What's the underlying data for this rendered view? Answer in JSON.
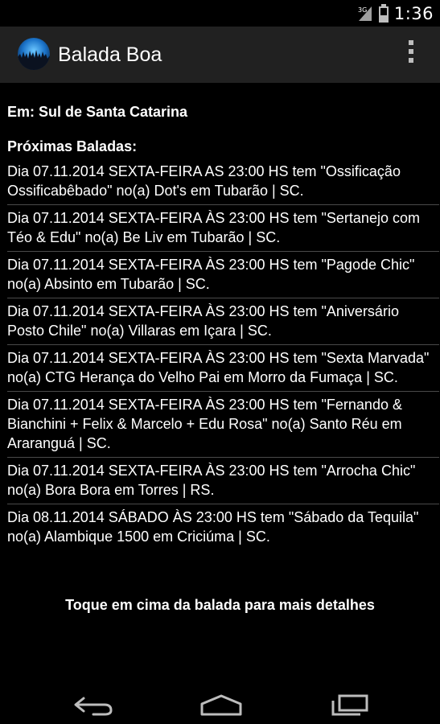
{
  "status_bar": {
    "signal_label": "3G",
    "time": "1:36"
  },
  "action_bar": {
    "title": "Balada Boa",
    "app_icon": "crowd-globe-icon",
    "overflow_icon": "overflow-menu-icon"
  },
  "content": {
    "region": "Em: Sul de Santa Catarina",
    "section_title": "Próximas Baladas:",
    "events": [
      "Dia 07.11.2014 SEXTA-FEIRA AS 23:00 HS tem \"Ossificação Ossificabêbado\" no(a) Dot's em Tubarão | SC.",
      "Dia 07.11.2014 SEXTA-FEIRA ÀS 23:00 HS tem \"Sertanejo com Téo & Edu\" no(a) Be Liv em Tubarão | SC.",
      "Dia 07.11.2014 SEXTA-FEIRA ÀS 23:00 HS tem \"Pagode Chic\" no(a) Absinto em Tubarão | SC.",
      "Dia 07.11.2014 SEXTA-FEIRA ÀS 23:00 HS tem \"Aniversário Posto Chile\" no(a) Villaras em Içara | SC.",
      "Dia 07.11.2014 SEXTA-FEIRA ÀS 23:00 HS tem \"Sexta Marvada\" no(a) CTG Herança do Velho Pai em Morro da Fumaça | SC.",
      "Dia 07.11.2014 SEXTA-FEIRA ÀS 23:00 HS tem \"Fernando & Bianchini + Felix & Marcelo + Edu Rosa\" no(a) Santo Réu em Araranguá | SC.",
      "Dia 07.11.2014 SEXTA-FEIRA ÀS 23:00 HS tem \"Arrocha Chic\" no(a) Bora Bora em Torres | RS.",
      "Dia 08.11.2014 SÁBADO ÀS 23:00 HS tem \"Sábado da Tequila\" no(a) Alambique 1500 em Criciúma | SC."
    ],
    "hint": "Toque em cima da balada para mais detalhes"
  },
  "nav_bar": {
    "back_icon": "back-icon",
    "home_icon": "home-icon",
    "recents_icon": "recent-apps-icon"
  },
  "colors": {
    "background": "#000000",
    "action_bar": "#212121",
    "divider": "#4a4a4a",
    "text": "#ffffff"
  }
}
